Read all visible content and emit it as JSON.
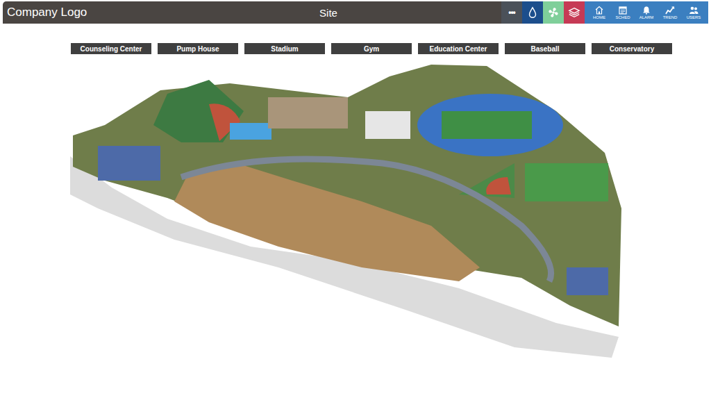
{
  "header": {
    "logo": "Company Logo",
    "title": "Site"
  },
  "tools": [
    {
      "label": "•••",
      "color": "#4b5159"
    },
    {
      "color": "#1c4e8c"
    },
    {
      "color": "#7fcf9a"
    },
    {
      "color": "#c63a55"
    }
  ],
  "nav": [
    {
      "label": "HOME"
    },
    {
      "label": "SCHED"
    },
    {
      "label": "ALARM"
    },
    {
      "label": "TREND"
    },
    {
      "label": "USERS"
    }
  ],
  "buildings": [
    {
      "label": "Counseling Center"
    },
    {
      "label": "Pump House"
    },
    {
      "label": "Stadium"
    },
    {
      "label": "Gym"
    },
    {
      "label": "Education Center"
    },
    {
      "label": "Baseball"
    },
    {
      "label": "Conservatory"
    }
  ]
}
